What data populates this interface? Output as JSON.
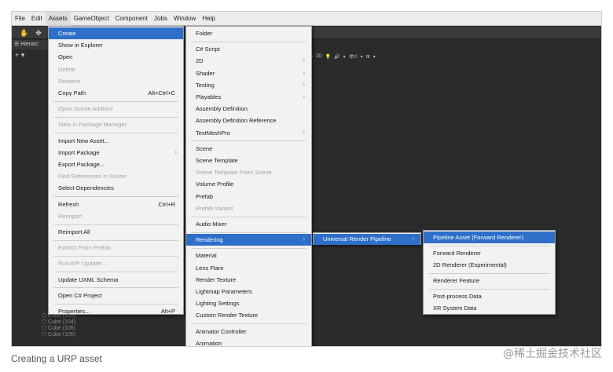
{
  "menubar": [
    "File",
    "Edit",
    "Assets",
    "GameObject",
    "Component",
    "Jobs",
    "Window",
    "Help"
  ],
  "hierarchy": {
    "title": "Hierarc",
    "tools": "+ ▾"
  },
  "scene_toolbar": [
    "▾",
    "2D",
    "💡",
    "🔊",
    "▾",
    "👁0",
    "▾",
    "⊞",
    "▾"
  ],
  "hierarchy_items": [
    "Cube (103)",
    "Cube (104)",
    "Cube (105)",
    "Cube (106)"
  ],
  "assets_menu": [
    {
      "label": "Create",
      "highlight": true
    },
    {
      "label": "Show in Explorer"
    },
    {
      "label": "Open"
    },
    {
      "label": "Delete",
      "disabled": true
    },
    {
      "label": "Rename",
      "disabled": true
    },
    {
      "label": "Copy Path",
      "shortcut": "Alt+Ctrl+C"
    },
    {
      "sep": true
    },
    {
      "label": "Open Scene Additive",
      "disabled": true
    },
    {
      "sep": true
    },
    {
      "label": "View in Package Manager",
      "disabled": true
    },
    {
      "sep": true
    },
    {
      "label": "Import New Asset..."
    },
    {
      "label": "Import Package",
      "arrow": true
    },
    {
      "label": "Export Package..."
    },
    {
      "label": "Find References In Scene",
      "disabled": true
    },
    {
      "label": "Select Dependencies"
    },
    {
      "sep": true
    },
    {
      "label": "Refresh",
      "shortcut": "Ctrl+R"
    },
    {
      "label": "Reimport",
      "disabled": true
    },
    {
      "sep": true
    },
    {
      "label": "Reimport All"
    },
    {
      "sep": true
    },
    {
      "label": "Extract From Prefab",
      "disabled": true
    },
    {
      "sep": true
    },
    {
      "label": "Run API Updater...",
      "disabled": true
    },
    {
      "sep": true
    },
    {
      "label": "Update UXML Schema"
    },
    {
      "sep": true
    },
    {
      "label": "Open C# Project"
    },
    {
      "sep": true
    },
    {
      "label": "Properties...",
      "shortcut": "Alt+P"
    }
  ],
  "create_menu": [
    {
      "label": "Folder"
    },
    {
      "sep": true
    },
    {
      "label": "C# Script"
    },
    {
      "label": "2D",
      "arrow": true
    },
    {
      "label": "Shader",
      "arrow": true
    },
    {
      "label": "Testing",
      "arrow": true
    },
    {
      "label": "Playables",
      "arrow": true
    },
    {
      "label": "Assembly Definition"
    },
    {
      "label": "Assembly Definition Reference"
    },
    {
      "label": "TextMeshPro",
      "arrow": true
    },
    {
      "sep": true
    },
    {
      "label": "Scene"
    },
    {
      "label": "Scene Template"
    },
    {
      "label": "Scene Template From Scene",
      "disabled": true
    },
    {
      "label": "Volume Profile"
    },
    {
      "label": "Prefab"
    },
    {
      "label": "Prefab Variant",
      "disabled": true
    },
    {
      "sep": true
    },
    {
      "label": "Audio Mixer"
    },
    {
      "sep": true
    },
    {
      "label": "Rendering",
      "arrow": true,
      "highlight": true
    },
    {
      "sep": true
    },
    {
      "label": "Material"
    },
    {
      "label": "Lens Flare"
    },
    {
      "label": "Render Texture"
    },
    {
      "label": "Lightmap Parameters"
    },
    {
      "label": "Lighting Settings"
    },
    {
      "label": "Custom Render Texture"
    },
    {
      "sep": true
    },
    {
      "label": "Animator Controller"
    },
    {
      "label": "Animation"
    }
  ],
  "rendering_menu": [
    {
      "label": "Universal Render Pipeline",
      "arrow": true,
      "highlight": true
    }
  ],
  "urp_menu": [
    {
      "label": "Pipeline Asset (Forward Renderer)",
      "highlight": true
    },
    {
      "sep": true
    },
    {
      "label": "Forward Renderer"
    },
    {
      "label": "2D Renderer (Experimental)"
    },
    {
      "sep": true
    },
    {
      "label": "Renderer Feature"
    },
    {
      "sep": true
    },
    {
      "label": "Post-process Data"
    },
    {
      "label": "XR System Data"
    }
  ],
  "caption": "Creating a URP asset",
  "watermark": "@稀土掘金技术社区",
  "colors": {
    "highlight": "#2d6fc9",
    "menu_bg": "#f2f2f2",
    "editor_bg": "#2b2b2b"
  }
}
